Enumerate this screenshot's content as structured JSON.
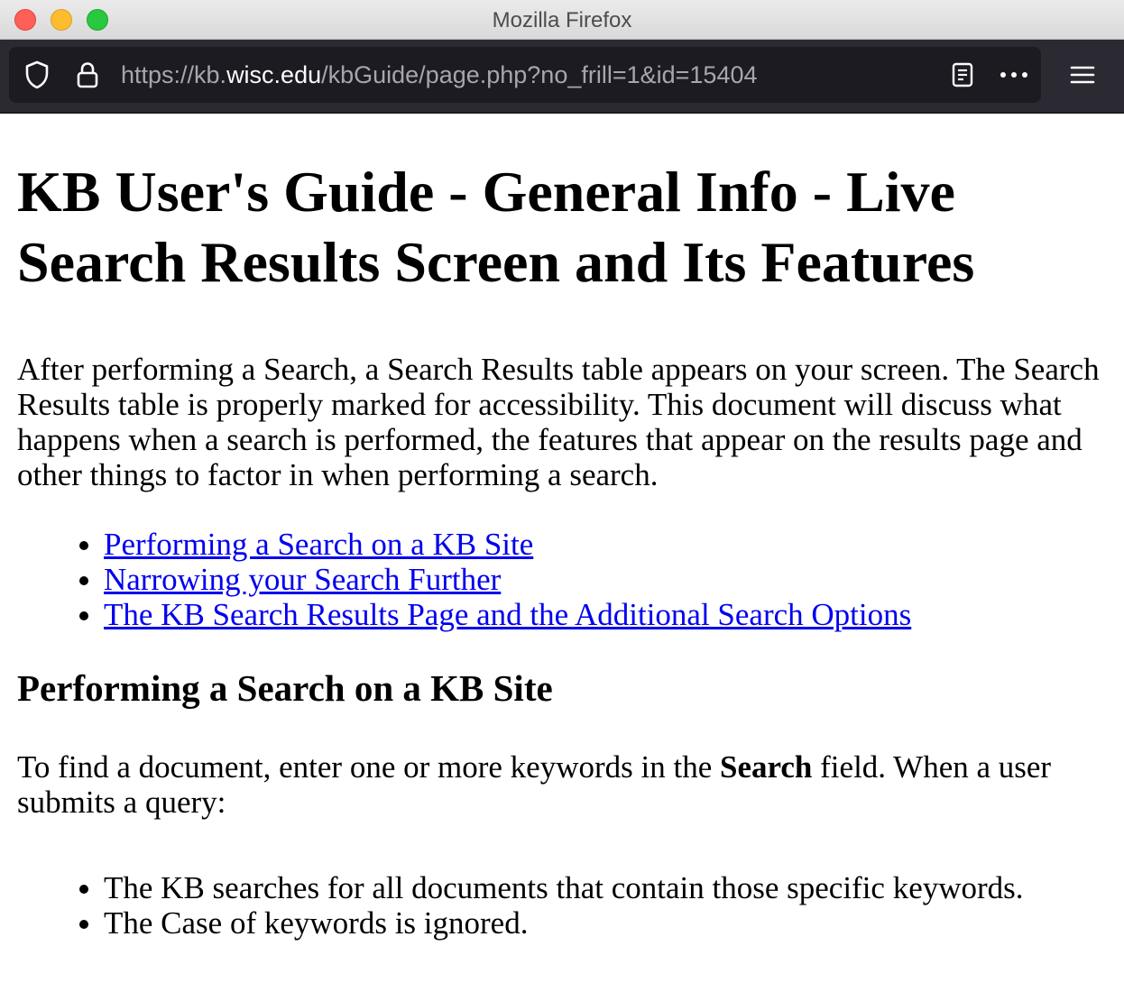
{
  "window": {
    "title": "Mozilla Firefox"
  },
  "toolbar": {
    "url_prefix": "https://kb.",
    "url_domain": "wisc.edu",
    "url_path": "/kbGuide/page.php?no_frill=1&id=15404"
  },
  "page": {
    "title": "KB User's Guide - General Info - Live Search Results Screen and Its Features",
    "intro": "After performing a Search, a Search Results table appears on your screen. The Search Results table is properly marked for accessibility. This document will discuss what happens when a search is performed, the features that appear on the results page and other things to factor in when performing a search.",
    "toc": [
      "Performing a Search on a KB Site",
      "Narrowing your Search Further",
      "The KB Search Results Page and the Additional Search Options"
    ],
    "section1": {
      "heading": "Performing a Search on a KB Site",
      "para_before": "To find a document, enter one or more keywords in the ",
      "para_bold": "Search",
      "para_after": " field. When a user submits a query:",
      "items": [
        "The KB searches for all documents that contain those specific keywords.",
        "The Case of keywords is ignored."
      ]
    }
  }
}
